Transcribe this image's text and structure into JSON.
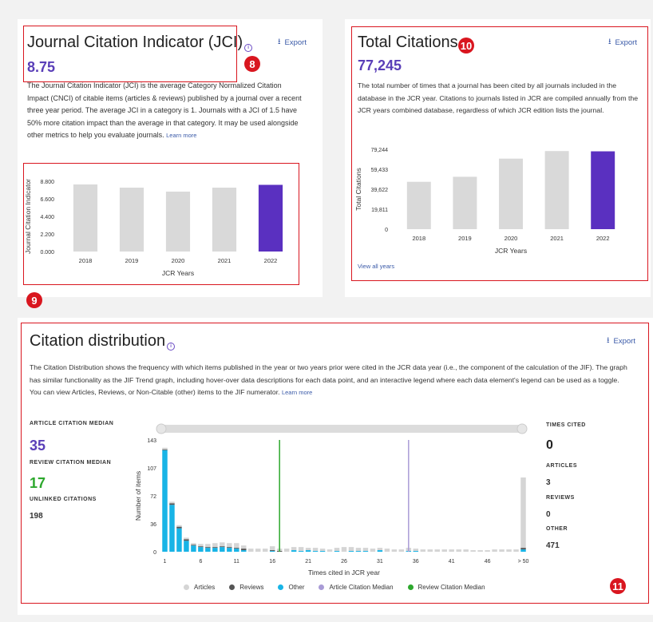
{
  "jci": {
    "title": "Journal Citation Indicator (JCI)",
    "info_icon": "info-icon",
    "export_label": "Export",
    "value": "8.75",
    "description": "The Journal Citation Indicator (JCI) is the average Category Normalized Citation Impact (CNCI) of citable items (articles & reviews) published by a journal over a recent three year period. The average JCI in a category is 1. Journals with a JCI of 1.5 have 50% more citation impact than the average in that category. It may be used alongside other metrics to help you evaluate journals.",
    "learn_more": "Learn more"
  },
  "total_citations": {
    "title": "Total Citations",
    "export_label": "Export",
    "value": "77,245",
    "description": "The total number of times that a journal has been cited by all journals included in the database in the JCR year. Citations to journals listed in JCR are compiled annually from the JCR years combined database, regardless of which JCR edition lists the journal.",
    "view_all": "View all years"
  },
  "citation_distribution": {
    "title": "Citation distribution",
    "export_label": "Export",
    "description": "The Citation Distribution shows the frequency with which items published in the year or two years prior were cited in the JCR data year (i.e., the component of the calculation of the JIF). The graph has similar functionality as the JIF Trend graph, including hover-over data descriptions for each data point, and an interactive legend where each data element's legend can be used as a toggle. You can view Articles, Reviews, or Non-Citable (other) items to the JIF numerator.",
    "learn_more": "Learn more",
    "article_median_label": "ARTICLE CITATION MEDIAN",
    "article_median": "35",
    "review_median_label": "REVIEW CITATION MEDIAN",
    "review_median": "17",
    "unlinked_label": "UNLINKED CITATIONS",
    "unlinked": "198",
    "times_cited_label": "TIMES CITED",
    "times_cited": "0",
    "articles_label": "ARTICLES",
    "articles": "3",
    "reviews_label": "REVIEWS",
    "reviews": "0",
    "other_label": "OTHER",
    "other": "471",
    "legend": [
      {
        "label": "Articles",
        "color": "#d5d5d5"
      },
      {
        "label": "Reviews",
        "color": "#555555"
      },
      {
        "label": "Other",
        "color": "#18b4e6"
      },
      {
        "label": "Article Citation Median",
        "color": "#a99bd6"
      },
      {
        "label": "Review Citation Median",
        "color": "#2da82d"
      }
    ]
  },
  "markers": [
    "8",
    "9",
    "10",
    "11"
  ],
  "chart_data": [
    {
      "type": "bar",
      "xlabel": "JCR Years",
      "ylabel": "Journal Citation Indicator",
      "categories": [
        "2018",
        "2019",
        "2020",
        "2021",
        "2022"
      ],
      "values": [
        8.4,
        8.0,
        7.5,
        8.0,
        8.35
      ],
      "highlight_index": 4,
      "ylim": [
        0,
        8.8
      ],
      "yticks": [
        "0.000",
        "2.200",
        "4.400",
        "6.600",
        "8.800"
      ],
      "colors": {
        "bar": "#d9d9d9",
        "highlight": "#5a30c0"
      }
    },
    {
      "type": "bar",
      "xlabel": "JCR Years",
      "ylabel": "Total Citations",
      "categories": [
        "2018",
        "2019",
        "2020",
        "2021",
        "2022"
      ],
      "values": [
        47000,
        52000,
        70000,
        77500,
        77245
      ],
      "highlight_index": 4,
      "ylim": [
        0,
        79244
      ],
      "yticks": [
        "0",
        "19,811",
        "39,622",
        "59,433",
        "79,244"
      ],
      "colors": {
        "bar": "#d9d9d9",
        "highlight": "#5a30c0"
      }
    },
    {
      "type": "bar",
      "xlabel": "Times cited in JCR year",
      "ylabel": "Number of items",
      "ylim": [
        0,
        143
      ],
      "yticks": [
        "0",
        "36",
        "72",
        "107",
        "143"
      ],
      "xticks": [
        "1",
        "6",
        "11",
        "16",
        "21",
        "26",
        "31",
        "36",
        "41",
        "46",
        "> 50"
      ],
      "series": [
        {
          "name": "Articles",
          "values": [
            2,
            2,
            2,
            2,
            2,
            3,
            4,
            5,
            5,
            5,
            6,
            4,
            4,
            4,
            4,
            5,
            3,
            4,
            4,
            5,
            3,
            4,
            3,
            3,
            4,
            6,
            5,
            4,
            4,
            4,
            3,
            4,
            3,
            3,
            4,
            3,
            3,
            3,
            3,
            3,
            3,
            3,
            3,
            2,
            2,
            2,
            3,
            3,
            3,
            3,
            90
          ]
        },
        {
          "name": "Reviews",
          "values": [
            1,
            2,
            2,
            2,
            1,
            1,
            1,
            1,
            1,
            1,
            1,
            2,
            0,
            0,
            0,
            1,
            1,
            0,
            0,
            0,
            0,
            0,
            0,
            0,
            0,
            0,
            0,
            0,
            0,
            0,
            0,
            0,
            0,
            0,
            0,
            0,
            0,
            0,
            0,
            0,
            0,
            0,
            0,
            0,
            0,
            0,
            0,
            0,
            0,
            0,
            2
          ]
        },
        {
          "name": "Other",
          "values": [
            130,
            60,
            30,
            14,
            8,
            6,
            5,
            5,
            6,
            5,
            4,
            2,
            0,
            0,
            0,
            1,
            0,
            0,
            2,
            1,
            2,
            1,
            1,
            0,
            1,
            0,
            1,
            1,
            1,
            0,
            2,
            0,
            0,
            0,
            1,
            1,
            0,
            0,
            0,
            0,
            0,
            0,
            0,
            0,
            0,
            0,
            0,
            0,
            0,
            0,
            3
          ]
        }
      ],
      "article_median_x": 35,
      "review_median_x": 17
    }
  ]
}
